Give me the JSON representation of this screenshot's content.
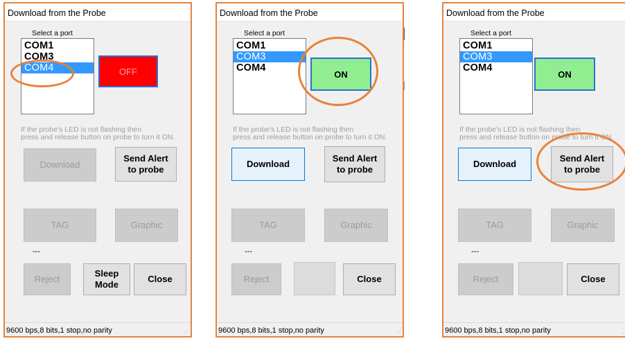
{
  "colors": {
    "accent_highlight": "#e8823a",
    "selection": "#3399ff",
    "led_off": "#ff0000",
    "led_on": "#90ee90"
  },
  "panels": [
    {
      "title": "Download from the  Probe",
      "port_label": "Select a port",
      "ports": [
        "COM1",
        "COM3",
        "COM4"
      ],
      "selected_port": "COM4",
      "led_status": "OFF",
      "hint_line1": "If the probe's LED is not flashing then",
      "hint_line2": "press and release button on probe to turn it ON.",
      "download": "Download",
      "send_alert_1": "Send Alert",
      "send_alert_2": "to probe",
      "tag": "TAG",
      "graphic": "Graphic",
      "dots": "---",
      "reject": "Reject",
      "sleep_1": "Sleep",
      "sleep_2": "Mode",
      "close": "Close",
      "status": "9600 bps,8 bits,1 stop,no parity"
    },
    {
      "title": "Download from the  Probe",
      "port_label": "Select a port",
      "ports": [
        "COM1",
        "COM3",
        "COM4"
      ],
      "selected_port": "COM3",
      "led_status": "ON",
      "hint_line1": "If the probe's LED is not flashing then",
      "hint_line2": "press and release button on probe to turn it ON.",
      "download": "Download",
      "send_alert_1": "Send Alert",
      "send_alert_2": "to probe",
      "tag": "TAG",
      "graphic": "Graphic",
      "dots": "---",
      "reject": "Reject",
      "close": "Close",
      "status": "9600 bps,8 bits,1 stop,no parity"
    },
    {
      "title": "Download from the  Probe",
      "port_label": "Select a port",
      "ports": [
        "COM1",
        "COM3",
        "COM4"
      ],
      "selected_port": "COM3",
      "led_status": "ON",
      "hint_line1": "If the probe's LED is not flashing then",
      "hint_line2": "press and release button on probe to turn it ON.",
      "download": "Download",
      "send_alert_1": "Send Alert",
      "send_alert_2": "to probe",
      "tag": "TAG",
      "graphic": "Graphic",
      "dots": "---",
      "reject": "Reject",
      "close": "Close",
      "status": "9600 bps,8 bits,1 stop,no parity"
    }
  ]
}
